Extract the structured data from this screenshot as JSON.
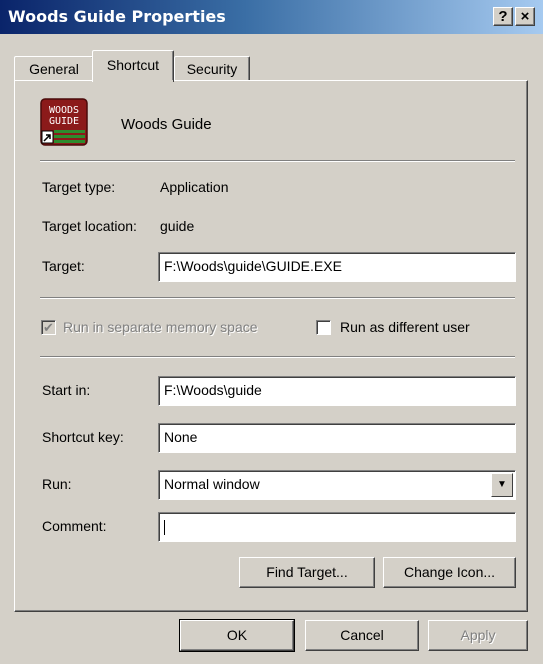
{
  "window": {
    "title": "Woods Guide Properties",
    "help_btn": "?",
    "close_btn": "×"
  },
  "tabs": [
    {
      "label": "General"
    },
    {
      "label": "Shortcut"
    },
    {
      "label": "Security"
    }
  ],
  "shortcut": {
    "name": "Woods Guide",
    "icon_text_line1": "WOODS",
    "icon_text_line2": "GUIDE",
    "target_type_label": "Target type:",
    "target_type_value": "Application",
    "target_location_label": "Target location:",
    "target_location_value": "guide",
    "target_label": "Target:",
    "target_value": "F:\\Woods\\guide\\GUIDE.EXE",
    "run_separate_label": "Run in separate memory space",
    "run_separate_checked": true,
    "run_as_user_label": "Run as different user",
    "run_as_user_checked": false,
    "start_in_label": "Start in:",
    "start_in_value": "F:\\Woods\\guide",
    "shortcut_key_label": "Shortcut key:",
    "shortcut_key_value": "None",
    "run_label": "Run:",
    "run_value": "Normal window",
    "comment_label": "Comment:",
    "comment_value": "",
    "find_target_label": "Find Target...",
    "change_icon_label": "Change Icon..."
  },
  "footer": {
    "ok_label": "OK",
    "cancel_label": "Cancel",
    "apply_label": "Apply"
  }
}
